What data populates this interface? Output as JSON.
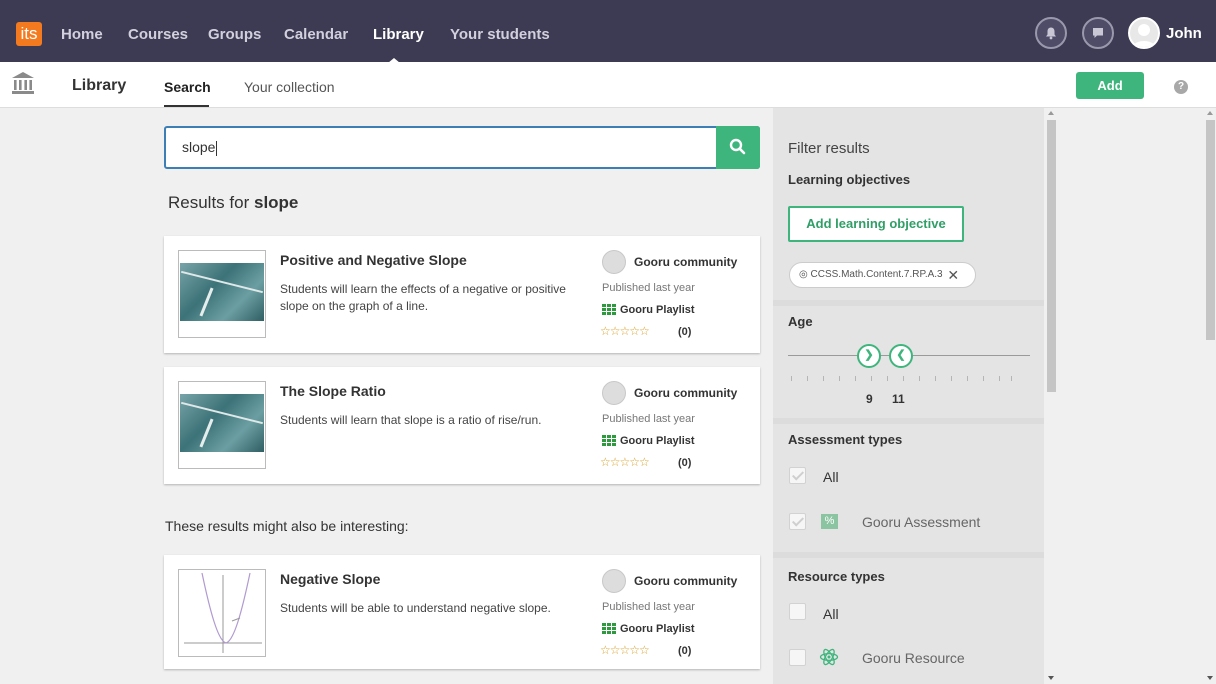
{
  "nav": {
    "logo": "its",
    "links": [
      "Home",
      "Courses",
      "Groups",
      "Calendar",
      "Library",
      "Your students"
    ],
    "active": "Library",
    "username": "John"
  },
  "subnav": {
    "title": "Library",
    "tabs": [
      "Search",
      "Your collection"
    ],
    "active_tab": "Search",
    "add_label": "Add",
    "help_symbol": "?"
  },
  "search": {
    "value": "slope",
    "results_prefix": "Results for ",
    "results_term": "slope"
  },
  "results": [
    {
      "title": "Positive and Negative Slope",
      "description": "Students will learn the effects of a negative or positive slope on the graph of a line.",
      "author": "Gooru community",
      "published": "Published last year",
      "type": "Gooru Playlist",
      "stars": "☆☆☆☆☆",
      "rating_count": "(0)",
      "thumb": "photo"
    },
    {
      "title": "The Slope Ratio",
      "description": "Students will learn that slope is a ratio of rise/run.",
      "author": "Gooru community",
      "published": "Published last year",
      "type": "Gooru Playlist",
      "stars": "☆☆☆☆☆",
      "rating_count": "(0)",
      "thumb": "photo"
    }
  ],
  "also_heading": "These results might also be interesting:",
  "also_results": [
    {
      "title": "Negative Slope",
      "description": "Students will be able to understand negative slope.",
      "author": "Gooru community",
      "published": "Published last year",
      "type": "Gooru Playlist",
      "stars": "☆☆☆☆☆",
      "rating_count": "(0)",
      "thumb": "graph"
    }
  ],
  "filters": {
    "title": "Filter results",
    "learning_objectives_label": "Learning objectives",
    "add_objective_label": "Add learning objective",
    "objective_tag": "CCSS.Math.Content.7.RP.A.3",
    "age_label": "Age",
    "age_min": "9",
    "age_max": "11",
    "assessment_types_label": "Assessment types",
    "assessment_options": [
      "All",
      "Gooru Assessment"
    ],
    "resource_types_label": "Resource types",
    "resource_options": [
      "All",
      "Gooru Resource"
    ]
  },
  "colors": {
    "nav_bg": "#3d3b53",
    "accent_green": "#3eb57c",
    "search_border": "#3c7fb6",
    "logo_orange": "#f47a20"
  }
}
